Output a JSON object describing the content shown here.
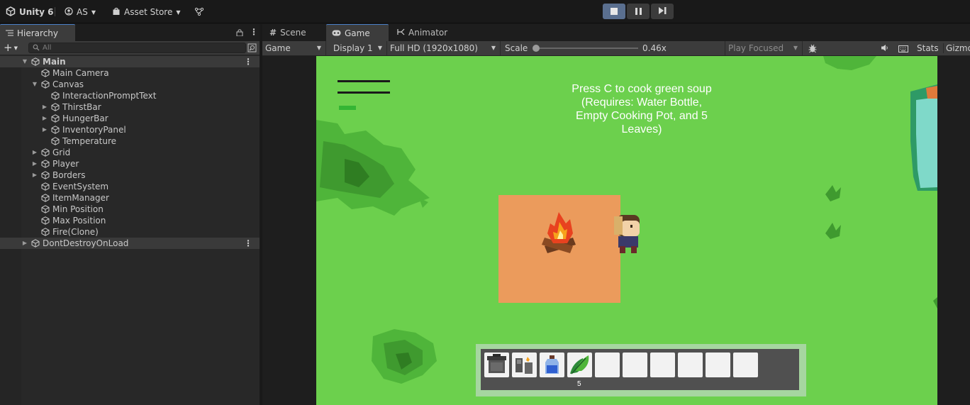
{
  "topbar": {
    "app_label": "Unity 6",
    "account_label": "AS",
    "asset_store_label": "Asset Store"
  },
  "hierarchy": {
    "tab_label": "Hierarchy",
    "search_placeholder": "All",
    "items": [
      {
        "label": "Main",
        "depth": 0,
        "expander": "open",
        "type": "scene"
      },
      {
        "label": "Main Camera",
        "depth": 1,
        "expander": "none",
        "type": "object"
      },
      {
        "label": "Canvas",
        "depth": 1,
        "expander": "open",
        "type": "object"
      },
      {
        "label": "InteractionPromptText",
        "depth": 2,
        "expander": "none",
        "type": "object"
      },
      {
        "label": "ThirstBar",
        "depth": 2,
        "expander": "closed",
        "type": "object"
      },
      {
        "label": "HungerBar",
        "depth": 2,
        "expander": "closed",
        "type": "object"
      },
      {
        "label": "InventoryPanel",
        "depth": 2,
        "expander": "closed",
        "type": "object"
      },
      {
        "label": "Temperature",
        "depth": 2,
        "expander": "none",
        "type": "object"
      },
      {
        "label": "Grid",
        "depth": 1,
        "expander": "closed",
        "type": "object"
      },
      {
        "label": "Player",
        "depth": 1,
        "expander": "closed",
        "type": "object"
      },
      {
        "label": "Borders",
        "depth": 1,
        "expander": "closed",
        "type": "object"
      },
      {
        "label": "EventSystem",
        "depth": 1,
        "expander": "none",
        "type": "object"
      },
      {
        "label": "ItemManager",
        "depth": 1,
        "expander": "none",
        "type": "object"
      },
      {
        "label": "Min Position",
        "depth": 1,
        "expander": "none",
        "type": "object"
      },
      {
        "label": "Max Position",
        "depth": 1,
        "expander": "none",
        "type": "object"
      },
      {
        "label": "Fire(Clone)",
        "depth": 1,
        "expander": "none",
        "type": "object"
      },
      {
        "label": "DontDestroyOnLoad",
        "depth": 0,
        "expander": "closed",
        "type": "scene"
      }
    ]
  },
  "tabs": {
    "scene": "Scene",
    "game": "Game",
    "animator": "Animator"
  },
  "game_toolbar": {
    "mode": "Game",
    "display": "Display 1",
    "resolution": "Full HD (1920x1080)",
    "scale_label": "Scale",
    "scale_value": "0.46x",
    "play_focus": "Play Focused",
    "stats": "Stats",
    "gizmos": "Gizmo"
  },
  "game": {
    "prompt_text": "Press C to cook green soup\n(Requires: Water Bottle, Empty Cooking Pot, and 5 Leaves)",
    "hotbar": {
      "slots": [
        "cooking-pot",
        "lighter",
        "water-bottle",
        "leaves",
        "",
        "",
        "",
        "",
        "",
        ""
      ],
      "leaf_count": "5"
    }
  },
  "colors": {
    "grass": "#6cd04d",
    "campfire_tile": "#eb9b5c",
    "hotbar_frame": "#a6d6a0",
    "hotbar_bg": "#505050",
    "accent": "#4a80c8"
  }
}
